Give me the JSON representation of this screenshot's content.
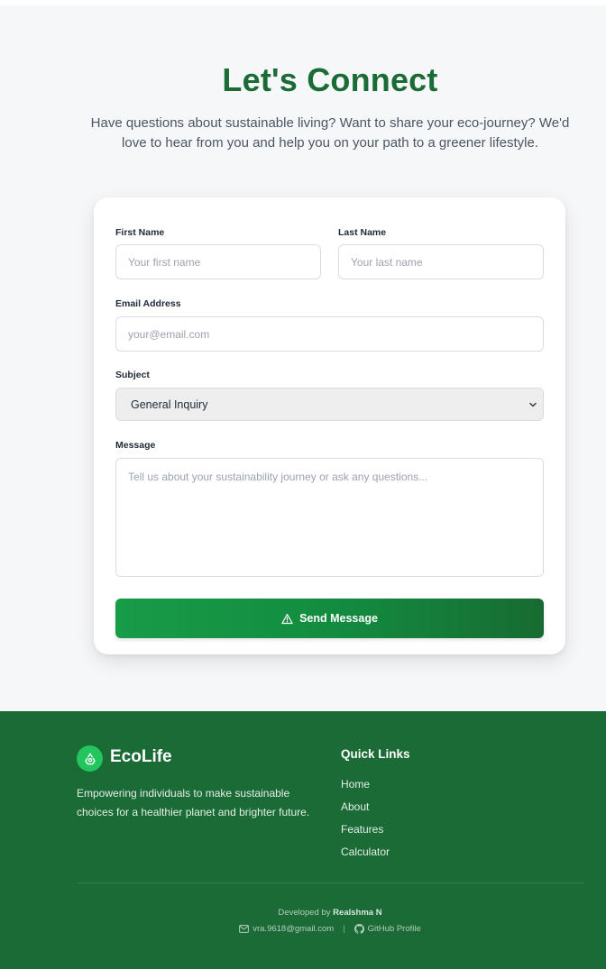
{
  "hero": {
    "title": "Let's Connect",
    "subtitle": "Have questions about sustainable living? Want to share your eco-journey? We'd love to hear from you and help you on your path to a greener lifestyle."
  },
  "form": {
    "first_name_label": "First Name",
    "first_name_placeholder": "Your first name",
    "last_name_label": "Last Name",
    "last_name_placeholder": "Your last name",
    "email_label": "Email Address",
    "email_placeholder": "your@email.com",
    "subject_label": "Subject",
    "subject_value": "General Inquiry",
    "message_label": "Message",
    "message_placeholder": "Tell us about your sustainability journey or ask any questions...",
    "send_label": "Send Message"
  },
  "footer": {
    "brand": "EcoLife",
    "description": "Empowering individuals to make sustainable choices for a healthier planet and brighter future.",
    "quick_links_title": "Quick Links",
    "quick_links": [
      "Home",
      "About",
      "Features",
      "Calculator"
    ],
    "developed_by_prefix": "Developed by",
    "developer": "Realshma N",
    "email": "vra.9618@gmail.com",
    "separator": "|",
    "github_label": "GitHub Profile"
  },
  "colors": {
    "brand_green": "#1a6b35",
    "accent_green": "#22c55e",
    "button_gradient_start": "#179c48"
  },
  "icons": {
    "send": "warning-triangle-icon",
    "brand": "recycle-icon",
    "email": "mail-icon",
    "github": "github-icon",
    "select": "chevron-down-icon"
  }
}
